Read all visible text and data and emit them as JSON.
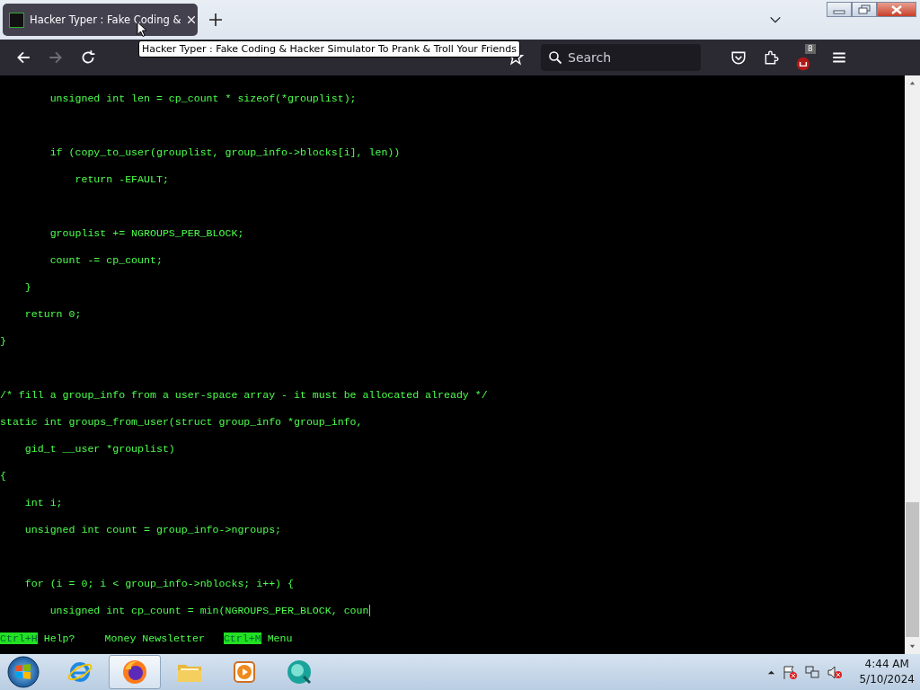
{
  "browser": {
    "tab": {
      "title": "Hacker Typer : Fake Coding &",
      "selected": true
    },
    "tooltip": "Hacker Typer : Fake Coding & Hacker Simulator To Prank & Troll Your Friends",
    "search": {
      "placeholder": "Search"
    },
    "extension_badge": "8"
  },
  "code": {
    "cursor": true,
    "lines": [
      {
        "kind": "code",
        "text": "        unsigned int len = cp_count * sizeof(*grouplist);"
      },
      {
        "kind": "blank"
      },
      {
        "kind": "code",
        "text": "        if (copy_to_user(grouplist, group_info->blocks[i], len))"
      },
      {
        "kind": "code",
        "text": "            return -EFAULT;"
      },
      {
        "kind": "blank"
      },
      {
        "kind": "code",
        "text": "        grouplist += NGROUPS_PER_BLOCK;"
      },
      {
        "kind": "code",
        "text": "        count -= cp_count;"
      },
      {
        "kind": "code",
        "text": "    }"
      },
      {
        "kind": "code",
        "text": "    return 0;"
      },
      {
        "kind": "code",
        "text": "}"
      },
      {
        "kind": "blank"
      },
      {
        "kind": "code",
        "text": "/* fill a group_info from a user-space array - it must be allocated already */"
      },
      {
        "kind": "code",
        "text": "static int groups_from_user(struct group_info *group_info,"
      },
      {
        "kind": "code",
        "text": "    gid_t __user *grouplist)"
      },
      {
        "kind": "code",
        "text": "{"
      },
      {
        "kind": "code",
        "text": "    int i;"
      },
      {
        "kind": "code",
        "text": "    unsigned int count = group_info->ngroups;"
      },
      {
        "kind": "blank"
      },
      {
        "kind": "code",
        "text": "    for (i = 0; i < group_info->nblocks; i++) {"
      },
      {
        "kind": "code",
        "text": "        unsigned int cp_count = min(NGROUPS_PER_BLOCK, coun"
      }
    ]
  },
  "footer": [
    {
      "kind": "key",
      "text": "Ctrl+H"
    },
    {
      "kind": "label",
      "text": "Help?"
    },
    {
      "kind": "link",
      "text": "Money Newsletter"
    },
    {
      "kind": "key",
      "text": "Ctrl+M"
    },
    {
      "kind": "label",
      "text": "Menu"
    }
  ],
  "taskbar": {
    "apps": [
      {
        "kind": "ie",
        "selected": false
      },
      {
        "kind": "firefox",
        "selected": true
      },
      {
        "kind": "folder",
        "selected": false
      },
      {
        "kind": "media",
        "selected": false
      },
      {
        "kind": "teal",
        "selected": false
      }
    ],
    "time": "4:44 AM",
    "date": "5/10/2024"
  }
}
